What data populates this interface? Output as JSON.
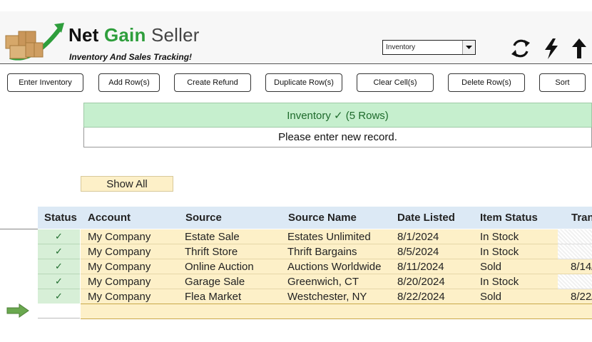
{
  "app": {
    "title_part1": "Net",
    "title_part2": "Gain",
    "title_part3": "Seller",
    "tagline": "Inventory And Sales Tracking!"
  },
  "view_select": {
    "value": "Inventory"
  },
  "header_icons": [
    "refresh-icon",
    "lightning-icon",
    "up-arrow-icon"
  ],
  "toolbar": {
    "buttons": [
      "Enter Inventory",
      "Add Row(s)",
      "Create Refund",
      "Duplicate Row(s)",
      "Clear Cell(s)",
      "Delete Row(s)",
      "Sort"
    ]
  },
  "status_bar": {
    "text": "Inventory  ✓ (5 Rows)",
    "message": "Please enter new record."
  },
  "filter": {
    "show_all_label": "Show All"
  },
  "table": {
    "columns": [
      "Status",
      "Account",
      "Source",
      "Source Name",
      "Date Listed",
      "Item Status",
      "Tran"
    ],
    "rows": [
      {
        "status": "✓",
        "account": "My Company",
        "source": "Estate Sale",
        "source_name": "Estates Unlimited",
        "date_listed": "8/1/2024",
        "item_status": "In Stock",
        "tran": ""
      },
      {
        "status": "✓",
        "account": "My Company",
        "source": "Thrift Store",
        "source_name": "Thrift Bargains",
        "date_listed": "8/5/2024",
        "item_status": "In Stock",
        "tran": ""
      },
      {
        "status": "✓",
        "account": "My Company",
        "source": "Online Auction",
        "source_name": "Auctions Worldwide",
        "date_listed": "8/11/2024",
        "item_status": "Sold",
        "tran": "8/14/"
      },
      {
        "status": "✓",
        "account": "My Company",
        "source": "Garage Sale",
        "source_name": "Greenwich, CT",
        "date_listed": "8/20/2024",
        "item_status": "In Stock",
        "tran": ""
      },
      {
        "status": "✓",
        "account": "My Company",
        "source": "Flea Market",
        "source_name": "Westchester, NY",
        "date_listed": "8/22/2024",
        "item_status": "Sold",
        "tran": "8/22/"
      }
    ]
  },
  "colors": {
    "brand_green": "#2e9e3c",
    "status_band": "#c6efce",
    "row_fill": "#fdf0c8",
    "header_fill": "#dce9f5",
    "arrow_green": "#6aa84f"
  }
}
